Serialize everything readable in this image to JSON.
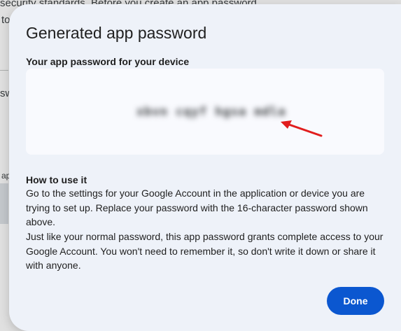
{
  "background": {
    "line1": "security standards. Before you create an app password",
    "line2": "to",
    "line3": "sw",
    "line4": "ap"
  },
  "dialog": {
    "title": "Generated app password",
    "subhead": "Your app password for your device",
    "password": "xbvn cqyf hgsa mdla",
    "howto_title": "How to use it",
    "howto_p1": "Go to the settings for your Google Account in the application or device you are trying to set up. Replace your password with the 16-character password shown above.",
    "howto_p2": "Just like your normal password, this app password grants complete access to your Google Account. You won't need to remember it, so don't write it down or share it with anyone.",
    "done_label": "Done"
  },
  "colors": {
    "accent": "#0b57d0",
    "dialog_bg": "#eef2f9",
    "arrow": "#e11d1d"
  },
  "icons": {
    "annotation": "red-arrow-icon"
  }
}
